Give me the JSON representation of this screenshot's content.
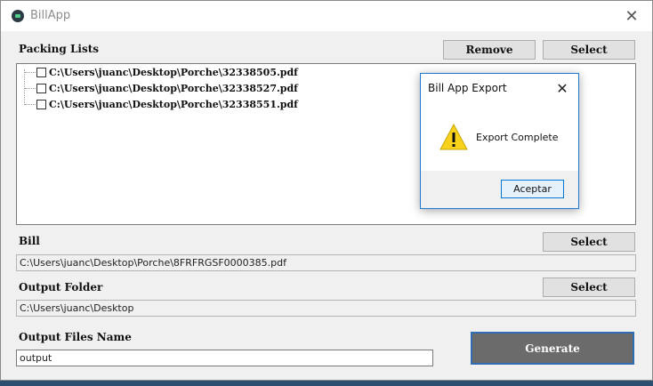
{
  "window": {
    "title": "BillApp",
    "icon": "app-icon",
    "close_glyph": "✕"
  },
  "packing_lists": {
    "label": "Packing Lists",
    "remove_label": "Remove",
    "select_label": "Select",
    "items": [
      {
        "path": "C:\\Users\\juanc\\Desktop\\Porche\\32338505.pdf",
        "checked": false
      },
      {
        "path": "C:\\Users\\juanc\\Desktop\\Porche\\32338527.pdf",
        "checked": false
      },
      {
        "path": "C:\\Users\\juanc\\Desktop\\Porche\\32338551.pdf",
        "checked": false
      }
    ]
  },
  "bill": {
    "label": "Bill",
    "select_label": "Select",
    "value": "C:\\Users\\juanc\\Desktop\\Porche\\8FRFRGSF0000385.pdf"
  },
  "output_folder": {
    "label": "Output Folder",
    "select_label": "Select",
    "value": "C:\\Users\\juanc\\Desktop"
  },
  "output_files_name": {
    "label": "Output Files Name",
    "value": "output"
  },
  "generate_label": "Generate",
  "dialog": {
    "title": "Bill App Export",
    "close_glyph": "✕",
    "message": "Export Complete",
    "ok_label": "Aceptar",
    "icon": "warning-icon"
  },
  "colors": {
    "accent": "#0078d7",
    "generate_bg": "#6b6b6b",
    "warning_yellow": "#f7d11a"
  }
}
